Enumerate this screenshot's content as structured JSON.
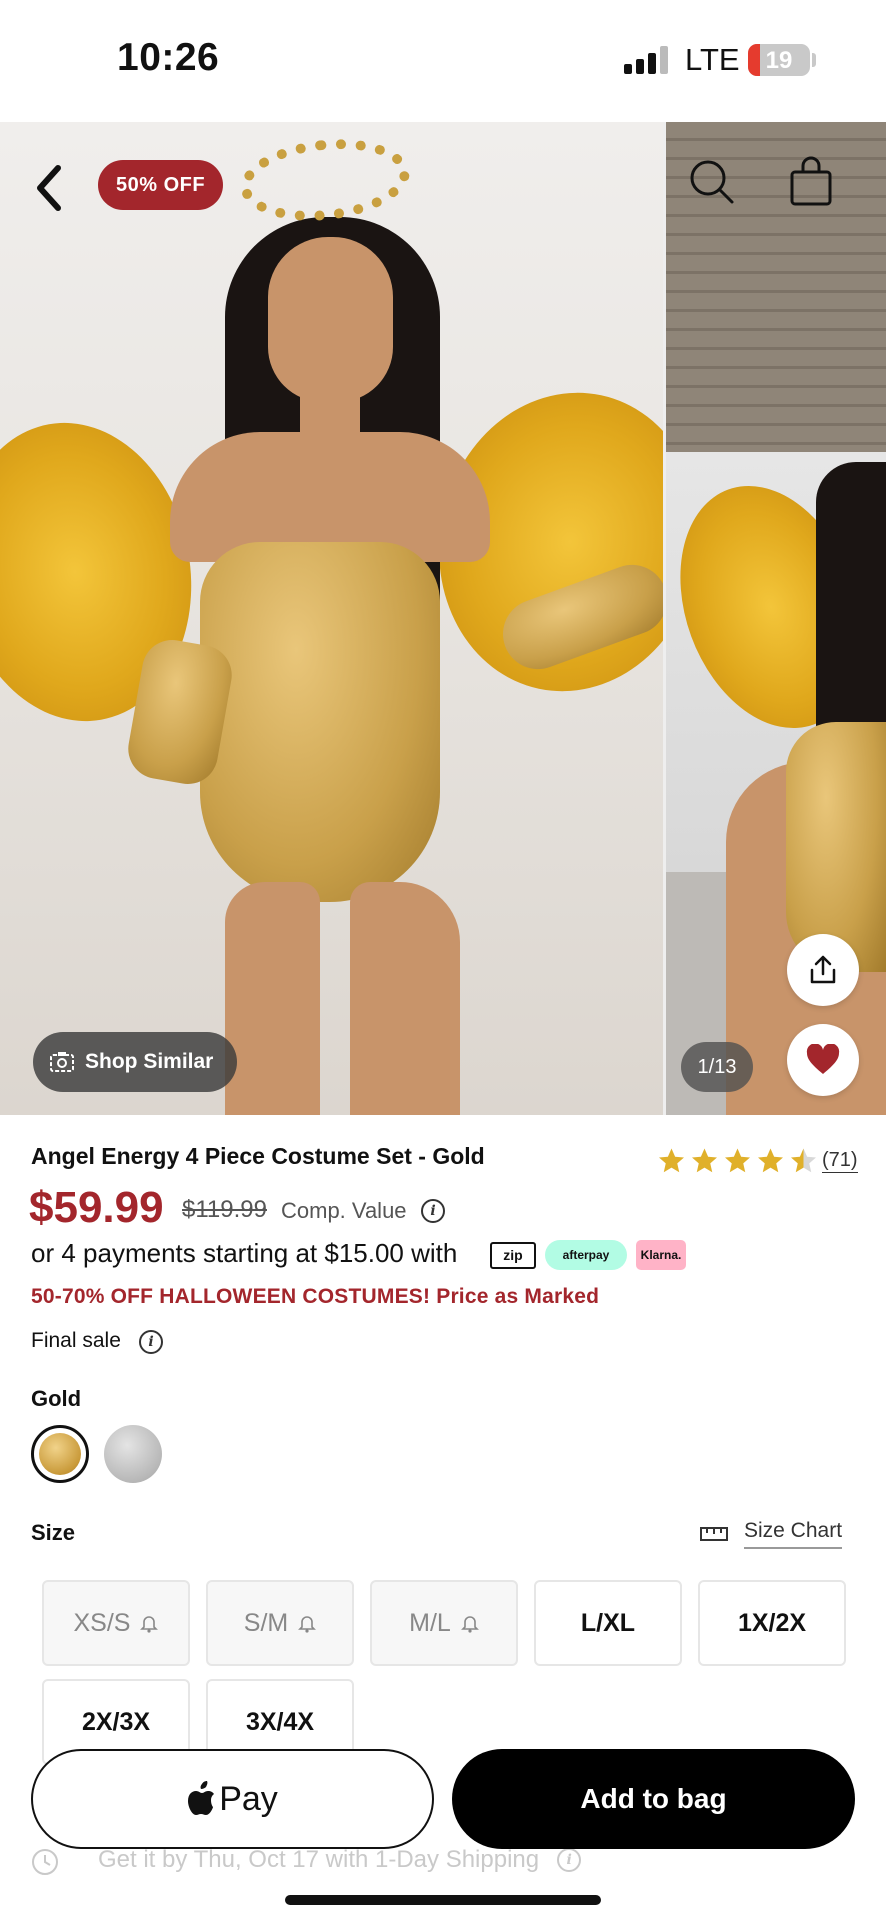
{
  "status_bar": {
    "time": "10:26",
    "network": "LTE",
    "battery": "19",
    "battery_level": 0.19
  },
  "gallery": {
    "discount_badge": "50% OFF",
    "shop_similar_label": "Shop Similar",
    "page_counter": "1/13"
  },
  "product": {
    "title": "Angel Energy 4 Piece Costume Set - Gold",
    "rating": 4.5,
    "review_count": "(71)",
    "price": "$59.99",
    "original_price": "$119.99",
    "comp_value_label": "Comp. Value",
    "payments_text": "or 4 payments starting at $15.00 with",
    "payment_providers": [
      "zip",
      "afterpay",
      "Klarna."
    ],
    "promo": "50-70% OFF HALLOWEEN COSTUMES! Price as Marked",
    "final_sale": "Final sale"
  },
  "colors": {
    "selected": "Gold",
    "options": [
      {
        "name": "Gold",
        "selected": true
      },
      {
        "name": "Silver",
        "selected": false
      }
    ]
  },
  "size": {
    "label": "Size",
    "chart_label": "Size Chart",
    "options": [
      {
        "label": "XS/S",
        "available": false
      },
      {
        "label": "S/M",
        "available": false
      },
      {
        "label": "M/L",
        "available": false
      },
      {
        "label": "L/XL",
        "available": true
      },
      {
        "label": "1X/2X",
        "available": true
      },
      {
        "label": "2X/3X",
        "available": true
      },
      {
        "label": "3X/4X",
        "available": true
      }
    ]
  },
  "actions": {
    "apple_pay_label": "Pay",
    "add_to_bag_label": "Add to bag",
    "shipping_text": "Get it by Thu, Oct 17 with 1-Day Shipping"
  },
  "theme": {
    "accent": "#a3262c",
    "star": "#e0b02a",
    "primary_button": "#000000"
  }
}
